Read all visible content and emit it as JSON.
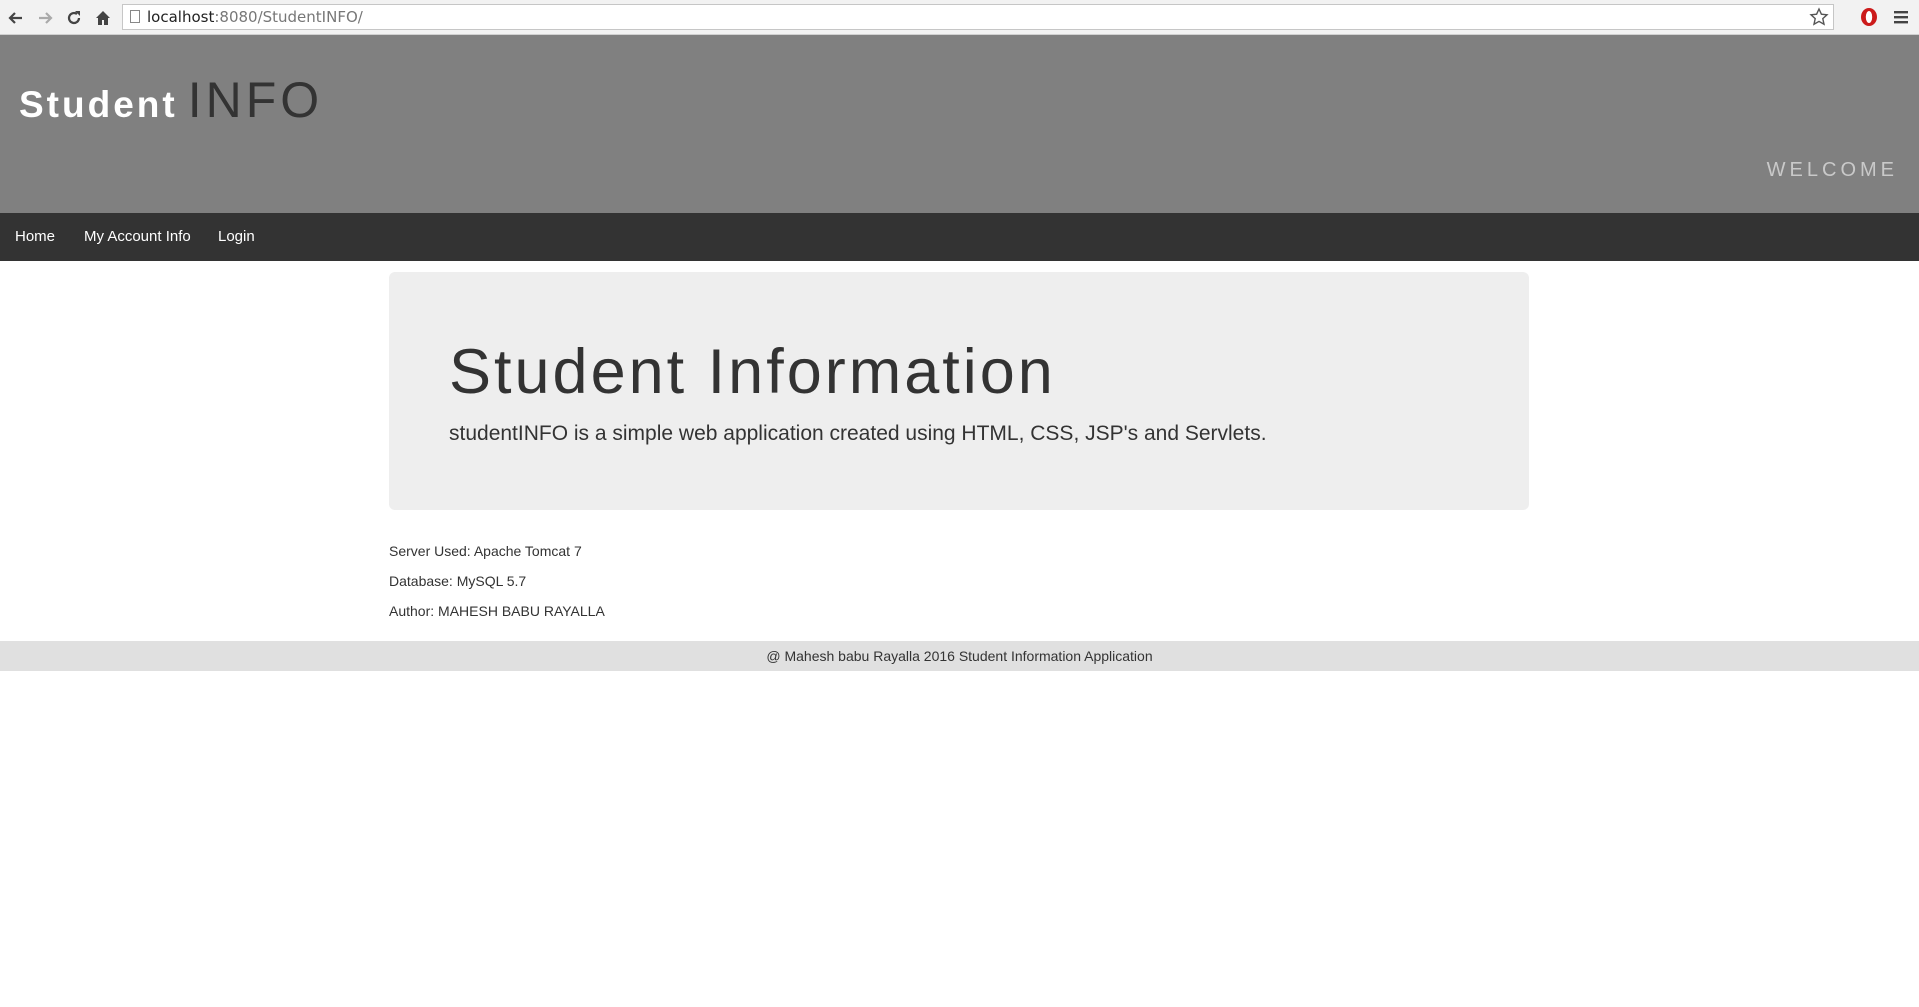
{
  "browser": {
    "url_host": "localhost",
    "url_rest": ":8080/StudentINFO/"
  },
  "header": {
    "brand_part1": "Student",
    "brand_part2": "INFO",
    "welcome": "WELCOME"
  },
  "nav": {
    "items": [
      {
        "label": "Home"
      },
      {
        "label": "My Account Info"
      },
      {
        "label": "Login"
      }
    ]
  },
  "jumbotron": {
    "title": "Student Information",
    "description": "studentINFO is a simple web application created using HTML, CSS, JSP's and Servlets."
  },
  "info": {
    "server": "Server Used: Apache Tomcat 7",
    "database": "Database: MySQL 5.7",
    "author": "Author: MAHESH BABU RAYALLA"
  },
  "footer": {
    "text": "@ Mahesh babu Rayalla 2016 Student Information Application"
  },
  "icons": {
    "back": "back-arrow-icon",
    "forward": "forward-arrow-icon",
    "reload": "reload-icon",
    "home": "home-icon",
    "page": "page-icon",
    "star": "bookmark-star-icon",
    "opera": "opera-icon",
    "menu": "menu-icon"
  },
  "colors": {
    "header_bg": "#808080",
    "nav_bg": "#333333",
    "jumbotron_bg": "#eeeeee",
    "footer_bg": "#e0e0e0",
    "opera_red": "#cc1b1b"
  }
}
